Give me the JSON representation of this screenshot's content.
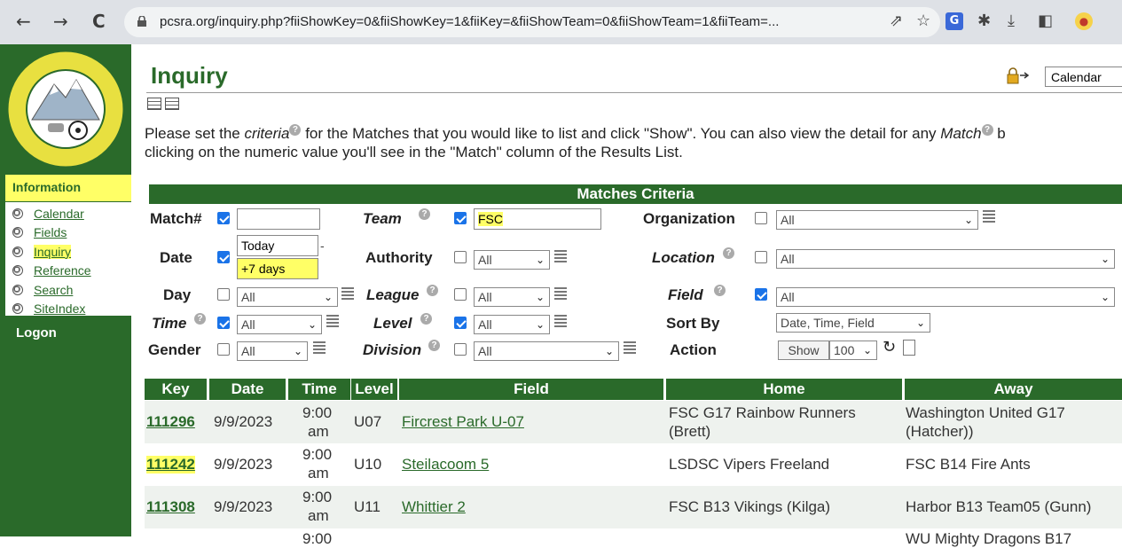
{
  "browser": {
    "url": "pcsra.org/inquiry.php?fiiShowKey=0&fiiShowKey=1&fiiKey=&fiiShowTeam=0&fiiShowTeam=1&fiiTeam=...",
    "back_icon": "←",
    "forward_icon": "→",
    "reload_icon": "C"
  },
  "sidebar": {
    "section_title": "Information",
    "items": [
      {
        "label": "Calendar"
      },
      {
        "label": "Fields"
      },
      {
        "label": "Inquiry"
      },
      {
        "label": "Reference"
      },
      {
        "label": "Search"
      },
      {
        "label": "SiteIndex"
      }
    ],
    "logon": "Logon"
  },
  "page": {
    "title": "Inquiry",
    "view_select": "Calendar",
    "intro_part1": "Please set the ",
    "intro_criteria": "criteria",
    "intro_part2": " for the Matches that you would like to list and click \"Show\". You can also view the detail for any ",
    "intro_match": "Match",
    "intro_part3": " b",
    "intro_line2": "clicking on the numeric value you'll see in the \"Match\" column of the Results List."
  },
  "criteria": {
    "heading": "Matches Criteria",
    "match_label": "Match#",
    "team_label": "Team",
    "team_value": "FSC",
    "organization_label": "Organization",
    "organization_value": "All",
    "date_label": "Date",
    "date_from": "Today",
    "date_to": "+7 days",
    "authority_label": "Authority",
    "authority_value": "All",
    "location_label": "Location",
    "location_value": "All",
    "day_label": "Day",
    "day_value": "All",
    "league_label": "League",
    "league_value": "All",
    "field_label": "Field",
    "field_value": "All",
    "time_label": "Time",
    "time_value": "All",
    "level_label": "Level",
    "level_value": "All",
    "sortby_label": "Sort By",
    "sortby_value": "Date, Time, Field",
    "gender_label": "Gender",
    "gender_value": "All",
    "division_label": "Division",
    "division_value": "All",
    "action_label": "Action",
    "show_button": "Show",
    "count_value": "100"
  },
  "results": {
    "headers": [
      "Key",
      "Date",
      "Time",
      "Level",
      "Field",
      "Home",
      "Away"
    ],
    "rows": [
      {
        "key": "111296",
        "date": "9/9/2023",
        "time1": "9:00",
        "time2": "am",
        "level": "U07",
        "field": "Fircrest Park U-07",
        "home1": "FSC G17 Rainbow Runners",
        "home2": "(Brett)",
        "away1": "Washington United G17",
        "away2": "(Hatcher))"
      },
      {
        "key": "111242",
        "date": "9/9/2023",
        "time1": "9:00",
        "time2": "am",
        "level": "U10",
        "field": "Steilacoom 5",
        "home1": "LSDSC Vipers Freeland",
        "home2": "",
        "away1": "FSC B14 Fire Ants",
        "away2": ""
      },
      {
        "key": "111308",
        "date": "9/9/2023",
        "time1": "9:00",
        "time2": "am",
        "level": "U11",
        "field": "Whittier 2",
        "home1": "FSC B13 Vikings (Kilga)",
        "home2": "",
        "away1": "Harbor B13 Team05 (Gunn)",
        "away2": ""
      }
    ],
    "partial_time": "9:00",
    "partial_away": "WU Mighty Dragons B17"
  }
}
